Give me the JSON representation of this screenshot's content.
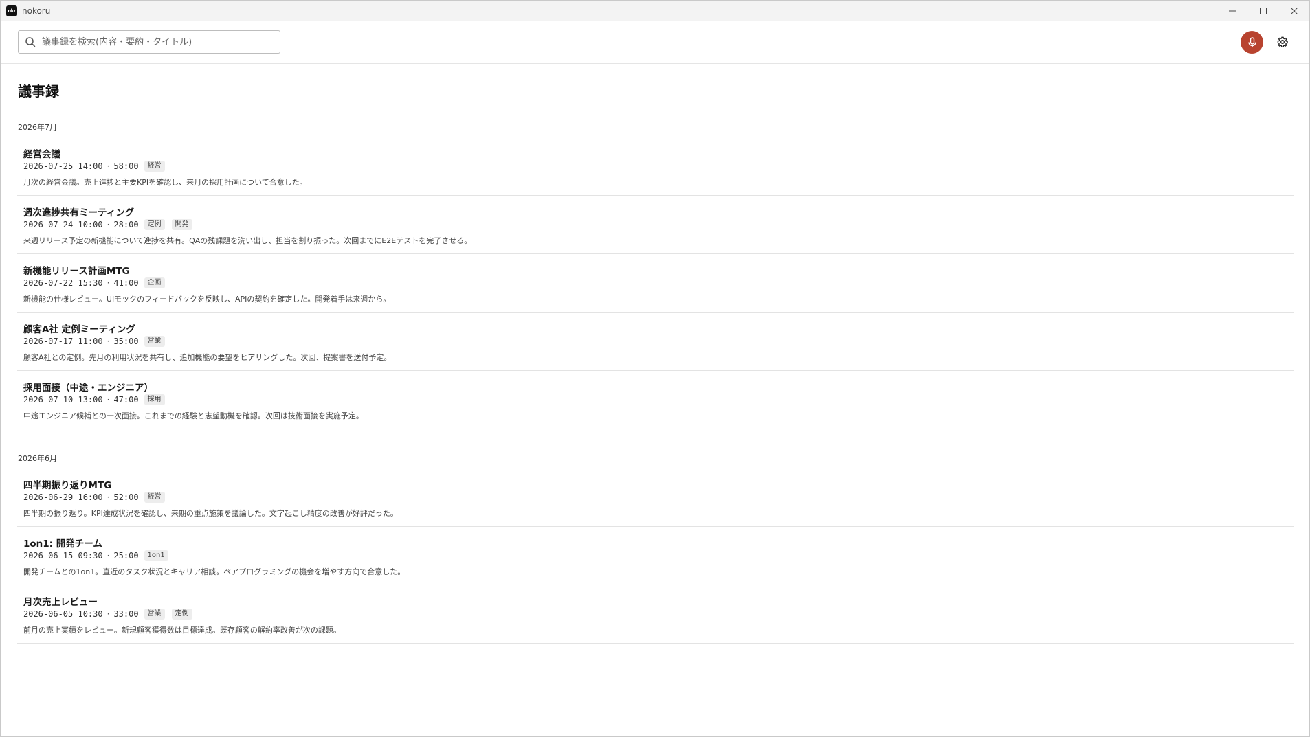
{
  "window": {
    "title": "nokoru",
    "logo_text": "nkr"
  },
  "search": {
    "placeholder": "議事録を検索(内容・要約・タイトル)",
    "value": ""
  },
  "page": {
    "title": "議事録"
  },
  "colors": {
    "accent": "#b8432f",
    "tag_bg": "#ededed",
    "divider": "#e3e3e3"
  },
  "months": [
    {
      "label": "2026年7月",
      "entries": [
        {
          "title": "経営会議",
          "date": "2026-07-25 14:00",
          "duration": "58:00",
          "tags": [
            "経営"
          ],
          "summary": "月次の経営会議。売上進捗と主要KPIを確認し、来月の採用計画について合意した。"
        },
        {
          "title": "週次進捗共有ミーティング",
          "date": "2026-07-24 10:00",
          "duration": "28:00",
          "tags": [
            "定例",
            "開発"
          ],
          "summary": "来週リリース予定の新機能について進捗を共有。QAの残課題を洗い出し、担当を割り振った。次回までにE2Eテストを完了させる。"
        },
        {
          "title": "新機能リリース計画MTG",
          "date": "2026-07-22 15:30",
          "duration": "41:00",
          "tags": [
            "企画"
          ],
          "summary": "新機能の仕様レビュー。UIモックのフィードバックを反映し、APIの契約を確定した。開発着手は来週から。"
        },
        {
          "title": "顧客A社 定例ミーティング",
          "date": "2026-07-17 11:00",
          "duration": "35:00",
          "tags": [
            "営業"
          ],
          "summary": "顧客A社との定例。先月の利用状況を共有し、追加機能の要望をヒアリングした。次回、提案書を送付予定。"
        },
        {
          "title": "採用面接（中途・エンジニア）",
          "date": "2026-07-10 13:00",
          "duration": "47:00",
          "tags": [
            "採用"
          ],
          "summary": "中途エンジニア候補との一次面接。これまでの経験と志望動機を確認。次回は技術面接を実施予定。"
        }
      ]
    },
    {
      "label": "2026年6月",
      "entries": [
        {
          "title": "四半期振り返りMTG",
          "date": "2026-06-29 16:00",
          "duration": "52:00",
          "tags": [
            "経営"
          ],
          "summary": "四半期の振り返り。KPI達成状況を確認し、来期の重点施策を議論した。文字起こし精度の改善が好評だった。"
        },
        {
          "title": "1on1: 開発チーム",
          "date": "2026-06-15 09:30",
          "duration": "25:00",
          "tags": [
            "1on1"
          ],
          "summary": "開発チームとの1on1。直近のタスク状況とキャリア相談。ペアプログラミングの機会を増やす方向で合意した。"
        },
        {
          "title": "月次売上レビュー",
          "date": "2026-06-05 10:30",
          "duration": "33:00",
          "tags": [
            "営業",
            "定例"
          ],
          "summary": "前月の売上実績をレビュー。新規顧客獲得数は目標達成。既存顧客の解約率改善が次の課題。"
        }
      ]
    }
  ]
}
